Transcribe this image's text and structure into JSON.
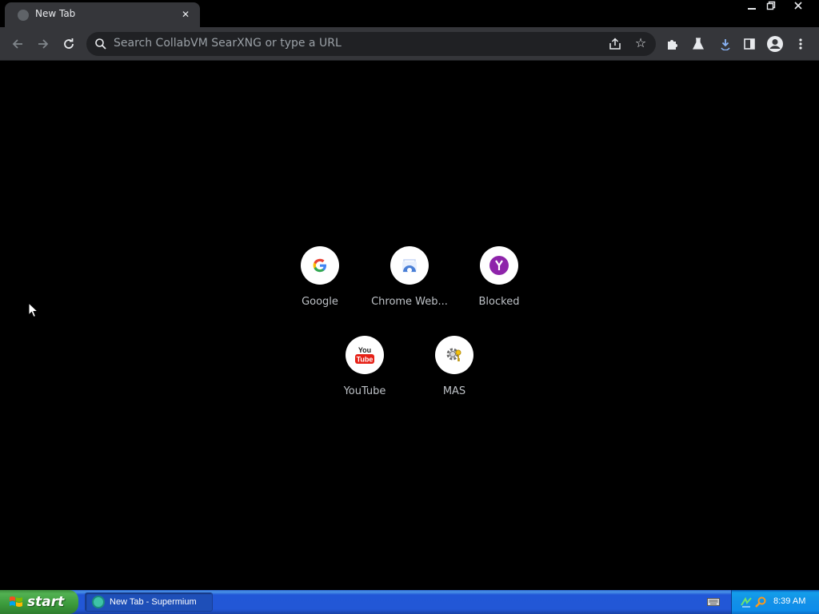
{
  "browser": {
    "tab_title": "New Tab",
    "omnibox_placeholder": "Search CollabVM SearXNG or type a URL"
  },
  "shortcuts": [
    {
      "label": "Google",
      "icon": "google-icon"
    },
    {
      "label": "Chrome Web...",
      "icon": "chrome-web-store-icon"
    },
    {
      "label": "Blocked",
      "icon": "blocked-y-icon"
    },
    {
      "label": "YouTube",
      "icon": "youtube-icon",
      "icon_text": [
        "You",
        "Tube"
      ]
    },
    {
      "label": "MAS",
      "icon": "gear-key-icon"
    }
  ],
  "taskbar": {
    "start_label": "start",
    "task_label": "New Tab - Supermium",
    "clock": "8:39 AM"
  },
  "colors": {
    "page_bg": "#000000",
    "toolbar_bg": "#35363a",
    "omnibox_bg": "#202124",
    "download_accent": "#8ab4f8",
    "taskbar_blue": "#2257d6",
    "start_green": "#3b9a3b"
  }
}
